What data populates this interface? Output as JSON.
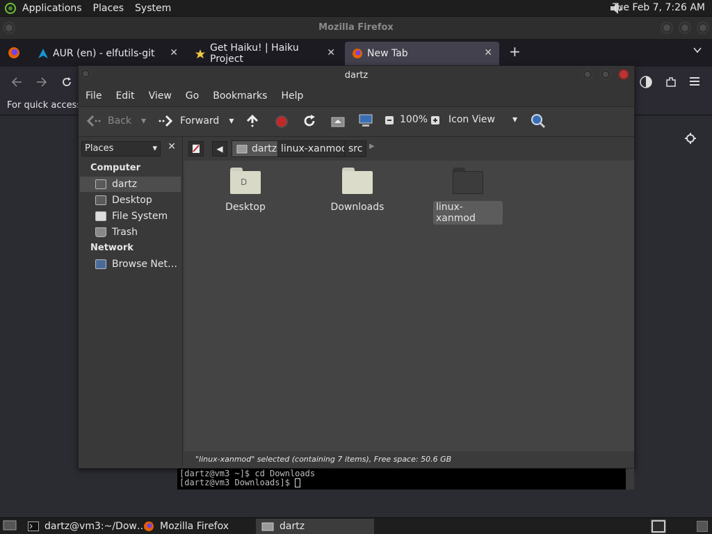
{
  "top_panel": {
    "menus": [
      "Applications",
      "Places",
      "System"
    ],
    "clock": "Tue Feb  7, 7:26 AM"
  },
  "firefox": {
    "window_title": "Mozilla Firefox",
    "tabs": [
      {
        "label": "AUR (en) - elfutils-git"
      },
      {
        "label": "Get Haiku! | Haiku Project"
      },
      {
        "label": "New Tab"
      }
    ],
    "bookmarks_hint": "For quick access,"
  },
  "file_manager": {
    "title": "dartz",
    "menu": [
      "File",
      "Edit",
      "View",
      "Go",
      "Bookmarks",
      "Help"
    ],
    "toolbar": {
      "back": "Back",
      "forward": "Forward",
      "zoom": "100%",
      "view_mode": "Icon View"
    },
    "sidebar": {
      "selector": "Places",
      "headers": [
        "Computer",
        "Network"
      ],
      "items": [
        "dartz",
        "Desktop",
        "File System",
        "Trash",
        "Browse Net…"
      ]
    },
    "path": [
      "dartz",
      "linux-xanmod",
      "src"
    ],
    "files": [
      "Desktop",
      "Downloads",
      "linux-xanmod"
    ],
    "status": "\"linux-xanmod\" selected (containing 7 items), Free space: 50.6 GB"
  },
  "terminal": {
    "lines": [
      "[dartz@vm3 ~]$ cd Downloads",
      "[dartz@vm3 Downloads]$ "
    ]
  },
  "taskbar": {
    "tasks": [
      "dartz@vm3:~/Dow…",
      "Mozilla Firefox",
      "dartz"
    ]
  },
  "colors": {
    "panel": "#1e1e1e",
    "window": "#3b3b3b",
    "firefox_tabbar": "#1c1b22",
    "stop_red": "#c0282a"
  }
}
